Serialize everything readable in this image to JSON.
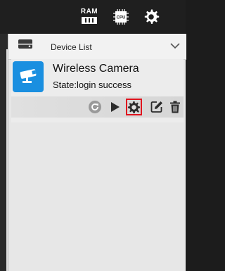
{
  "topbar": {
    "ram_label": "RAM",
    "cpu_label": "CPU",
    "icons": [
      "ram-icon",
      "cpu-icon",
      "gear-icon"
    ]
  },
  "panel": {
    "header_title": "Device List",
    "header_icon": "device-list-icon",
    "chevron_icon": "chevron-down-icon"
  },
  "device": {
    "name": "Wireless Camera",
    "state": "State:login success",
    "tile_color": "#1a8fe0",
    "actions": [
      "refresh-icon",
      "play-icon",
      "config-icon",
      "edit-icon",
      "trash-icon"
    ],
    "highlighted_action": "config-icon",
    "highlight_color": "#e0141e"
  }
}
